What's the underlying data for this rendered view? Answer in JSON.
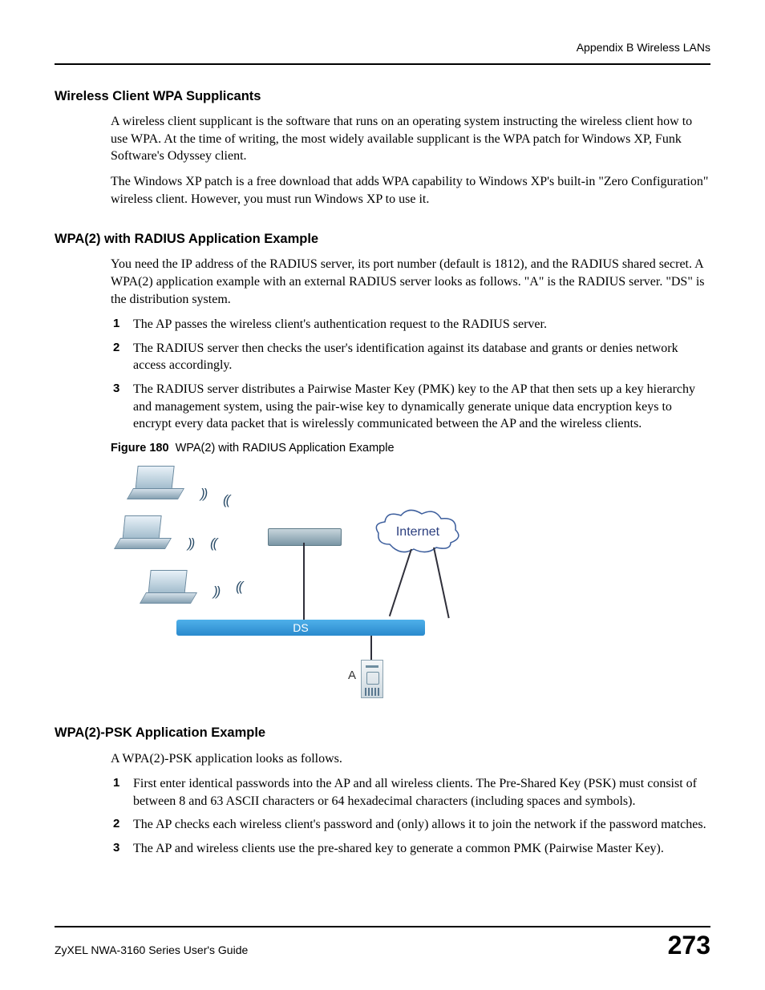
{
  "header": {
    "running": "Appendix B Wireless LANs"
  },
  "sections": {
    "s1": {
      "heading": "Wireless Client WPA Supplicants",
      "p1": "A wireless client supplicant is the software that runs on an operating system instructing the wireless client how to use WPA. At the time of writing, the most widely available supplicant is the WPA patch for Windows XP, Funk Software's Odyssey client.",
      "p2": "The Windows XP patch is a free download that adds WPA capability to Windows XP's built-in \"Zero Configuration\" wireless client. However, you must run Windows XP to use it."
    },
    "s2": {
      "heading": "WPA(2) with RADIUS Application Example",
      "p1": "You need the IP address of the RADIUS server, its port number (default is 1812), and the RADIUS shared secret. A WPA(2) application example with an external RADIUS server looks as follows. \"A\" is the RADIUS server. \"DS\" is the distribution system.",
      "items": [
        "The AP passes the wireless client's authentication request to the RADIUS server.",
        "The RADIUS server then checks the user's identification against its database and grants or denies network access accordingly.",
        "The RADIUS server distributes a Pairwise Master Key (PMK) key to the AP that then sets up a key hierarchy and management system, using the pair-wise key to dynamically generate unique data encryption keys to encrypt every data packet that is wirelessly communicated between the AP and the wireless clients."
      ],
      "figure": {
        "label": "Figure 180",
        "caption": "WPA(2) with RADIUS Application Example",
        "ds_label": "DS",
        "internet_label": "Internet",
        "server_label": "A"
      }
    },
    "s3": {
      "heading": "WPA(2)-PSK Application Example",
      "p1": "A WPA(2)-PSK application looks as follows.",
      "items": [
        "First enter identical passwords into the AP and all wireless clients. The Pre-Shared Key (PSK) must consist of between 8 and 63 ASCII characters or 64 hexadecimal characters (including spaces and symbols).",
        "The AP checks each wireless client's password and (only) allows it to join the network if the password matches.",
        "The AP and wireless clients use the pre-shared key to generate a common PMK (Pairwise Master Key)."
      ]
    }
  },
  "footer": {
    "book": "ZyXEL NWA-3160 Series User's Guide",
    "page": "273"
  }
}
